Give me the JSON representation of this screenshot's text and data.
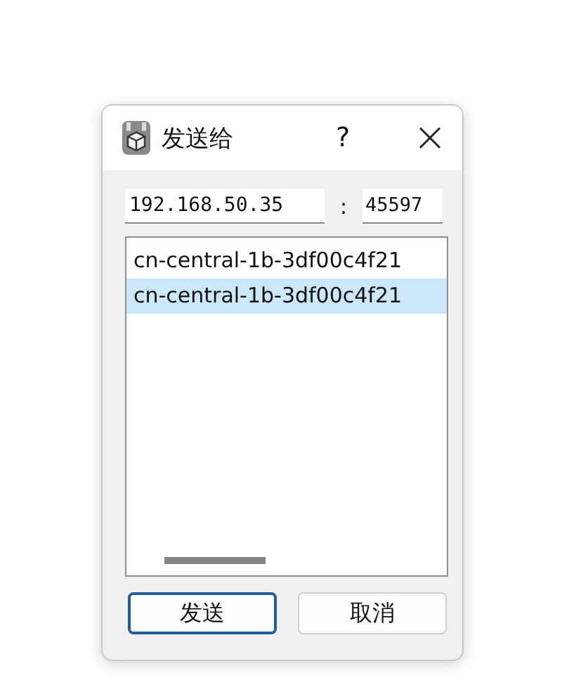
{
  "window": {
    "title": "发送给",
    "help": "?"
  },
  "address": {
    "host": "192.168.50.35",
    "separator": ":",
    "port": "45597"
  },
  "list": {
    "items": [
      {
        "label": "cn-central-1b-3df00c4f21",
        "selected": false
      },
      {
        "label": "cn-central-1b-3df00c4f21",
        "selected": true
      }
    ]
  },
  "buttons": [
    {
      "label": "发送",
      "kind": "default"
    },
    {
      "label": "取消",
      "kind": "normal"
    }
  ]
}
